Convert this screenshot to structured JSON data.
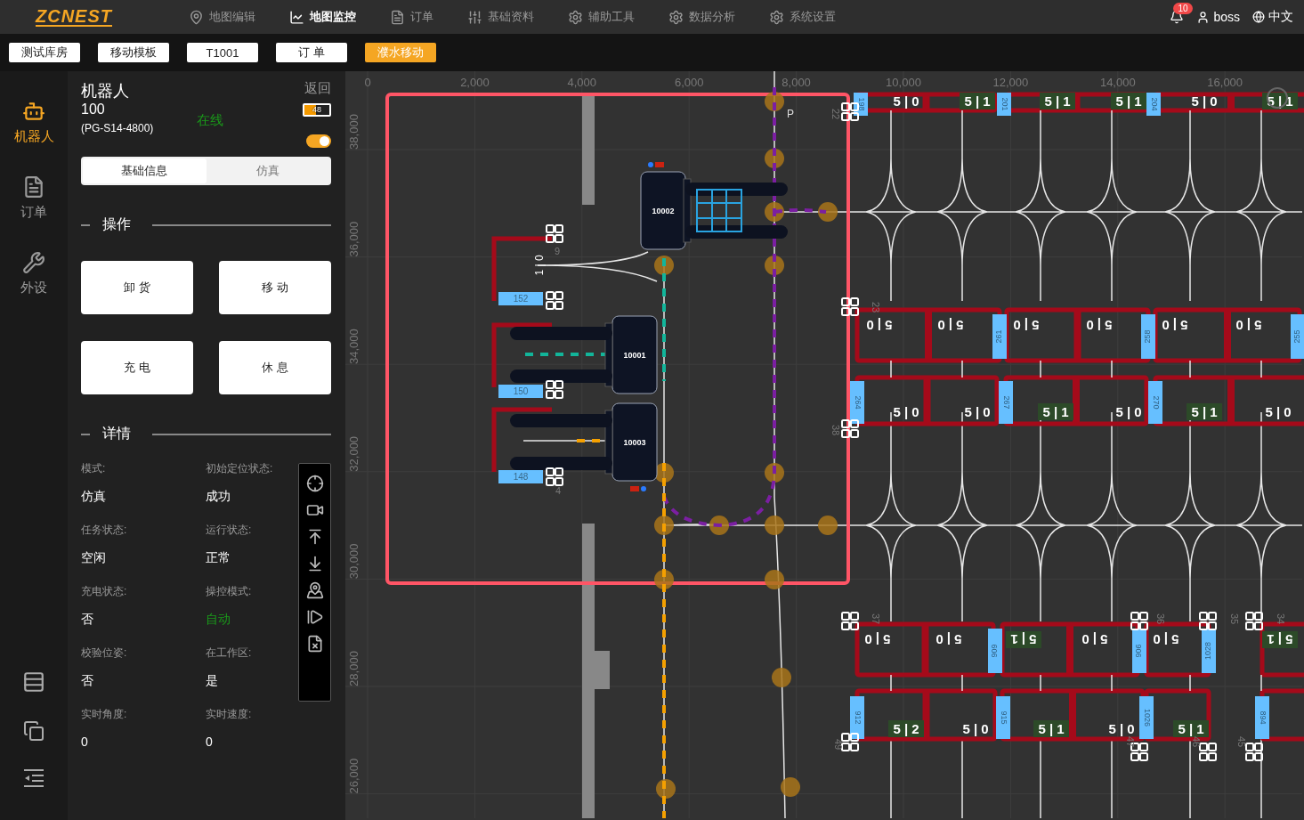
{
  "app": {
    "logo": "ZCNEST"
  },
  "nav": [
    {
      "label": "地图编辑",
      "selected": false
    },
    {
      "label": "地图监控",
      "selected": true
    },
    {
      "label": "订单",
      "selected": false
    },
    {
      "label": "基础资料",
      "selected": false
    },
    {
      "label": "辅助工具",
      "selected": false
    },
    {
      "label": "数据分析",
      "selected": false
    },
    {
      "label": "系统设置",
      "selected": false
    }
  ],
  "notifications": {
    "count": "10"
  },
  "user": {
    "name": "boss"
  },
  "language": "中文",
  "open_tabs": [
    {
      "label": "测试库房",
      "selected": false
    },
    {
      "label": "移动模板",
      "selected": false
    },
    {
      "label": "T1001",
      "selected": false
    },
    {
      "label": "订 单",
      "selected": false
    },
    {
      "label": "濮水移动",
      "selected": true
    }
  ],
  "sidebar": {
    "items": [
      {
        "label": "机器人",
        "selected": true
      },
      {
        "label": "订单",
        "selected": false
      },
      {
        "label": "外设",
        "selected": false
      }
    ]
  },
  "robot_panel": {
    "title": "机器人",
    "back": "返回",
    "id": "100",
    "model": "(PG-S14-4800)",
    "status": "在线",
    "online": true,
    "battery": {
      "reading": "48",
      "level": 0.48
    },
    "enabled": true,
    "tabs": [
      {
        "label": "基础信息",
        "selected": true
      },
      {
        "label": "仿真",
        "selected": false
      }
    ],
    "operations_title": "操作",
    "operations": [
      "卸 货",
      "移 动",
      "充 电",
      "休 息"
    ],
    "details_title": "详情",
    "details": [
      {
        "label": "模式:",
        "value": "仿真",
        "highlight": false
      },
      {
        "label": "初始定位状态:",
        "value": "成功",
        "highlight": false
      },
      {
        "label": "任务状态:",
        "value": "空闲",
        "highlight": false
      },
      {
        "label": "运行状态:",
        "value": "正常",
        "highlight": false
      },
      {
        "label": "充电状态:",
        "value": "否",
        "highlight": false
      },
      {
        "label": "操控模式:",
        "value": "自动",
        "highlight": true
      },
      {
        "label": "校验位姿:",
        "value": "否",
        "highlight": false
      },
      {
        "label": "在工作区:",
        "value": "是",
        "highlight": false
      },
      {
        "label": "实时角度:",
        "value": "0",
        "highlight": false
      },
      {
        "label": "实时速度:",
        "value": "0",
        "highlight": false
      }
    ]
  },
  "map": {
    "x_ticks": [
      "0",
      "2,000",
      "4,000",
      "6,000",
      "8,000",
      "10,000",
      "12,000",
      "14,000",
      "16,000"
    ],
    "y_ticks": [
      "38,000",
      "36,000",
      "34,000",
      "32,000",
      "30,000",
      "28,000",
      "26,000"
    ],
    "robots": [
      {
        "id": "10002",
        "loaded": true,
        "color": "#7b1fa2"
      },
      {
        "id": "10001",
        "loaded": false,
        "color": "#12b59a"
      },
      {
        "id": "10003",
        "loaded": false,
        "color": "#f5a000"
      }
    ],
    "stations": [
      "152",
      "150",
      "148"
    ],
    "labels": [
      "P",
      "1 | 0"
    ],
    "node_numbers": [
      "9",
      "4",
      "22",
      "23",
      "38",
      "37",
      "36",
      "35",
      "34",
      "49",
      "47",
      "46",
      "45"
    ],
    "shelf_rows": [
      {
        "tags": [
          "198",
          "201",
          "204"
        ],
        "slots": [
          {
            "text": "5 | 0",
            "occupied": false
          },
          {
            "text": "5 | 1",
            "occupied": true
          },
          {
            "text": "5 | 1",
            "occupied": true
          },
          {
            "text": "5 | 1",
            "occupied": true
          },
          {
            "text": "5 | 0",
            "occupied": false
          },
          {
            "text": "5 | 1",
            "occupied": true
          }
        ]
      },
      {
        "tags": [
          "261",
          "258",
          "255"
        ],
        "slots": [
          {
            "text": "5 | 0",
            "occupied": false
          },
          {
            "text": "5 | 0",
            "occupied": false
          },
          {
            "text": "5 | 0",
            "occupied": false
          },
          {
            "text": "5 | 0",
            "occupied": false
          },
          {
            "text": "5 | 0",
            "occupied": false
          },
          {
            "text": "5 | 0",
            "occupied": false
          }
        ]
      },
      {
        "tags": [
          "264",
          "267",
          "270"
        ],
        "slots": [
          {
            "text": "5 | 0",
            "occupied": false
          },
          {
            "text": "5 | 0",
            "occupied": false
          },
          {
            "text": "5 | 1",
            "occupied": true
          },
          {
            "text": "5 | 0",
            "occupied": false
          },
          {
            "text": "5 | 1",
            "occupied": true
          },
          {
            "text": "5 | 0",
            "occupied": false
          }
        ]
      },
      {
        "tags": [
          "909",
          "906",
          "1028"
        ],
        "slots": [
          {
            "text": "5 | 0",
            "occupied": false
          },
          {
            "text": "5 | 0",
            "occupied": false
          },
          {
            "text": "5 | 1",
            "occupied": true
          },
          {
            "text": "5 | 0",
            "occupied": false
          },
          {
            "text": "5 | 0",
            "occupied": false
          },
          {
            "text": "5 | 1",
            "occupied": true
          }
        ]
      },
      {
        "tags": [
          "912",
          "915",
          "1026",
          "894"
        ],
        "slots": [
          {
            "text": "5 | 2",
            "occupied": true
          },
          {
            "text": "5 | 0",
            "occupied": false
          },
          {
            "text": "5 | 1",
            "occupied": true
          },
          {
            "text": "5 | 0",
            "occupied": false
          },
          {
            "text": "5 | 1",
            "occupied": true
          }
        ]
      }
    ]
  }
}
